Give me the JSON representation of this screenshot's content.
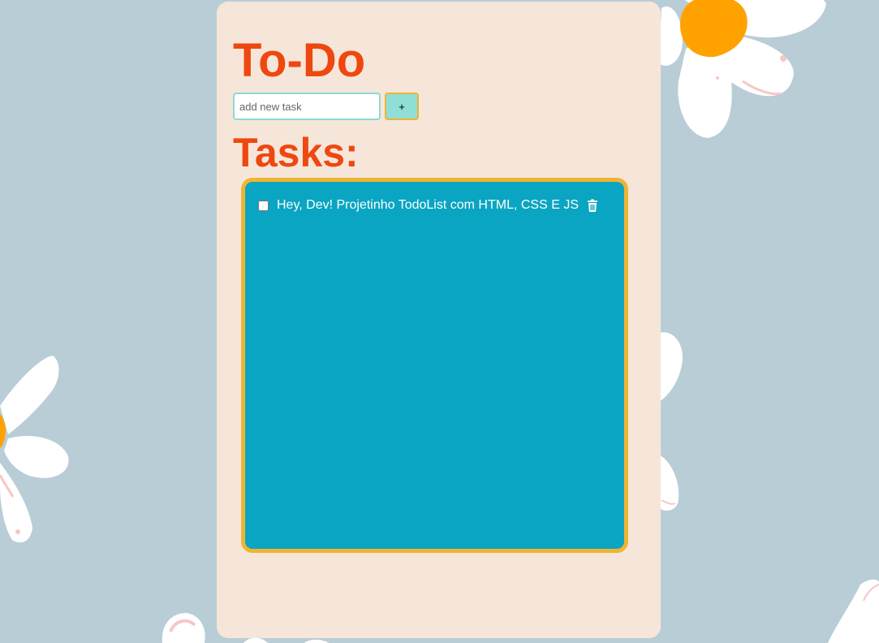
{
  "app": {
    "title": "To-Do"
  },
  "new_task": {
    "placeholder": "add new task",
    "value": "",
    "add_button_label": "+"
  },
  "tasks_section": {
    "heading": "Tasks:",
    "items": [
      {
        "text": "Hey, Dev! Projetinho TodoList com HTML, CSS E JS",
        "checked": false,
        "delete_icon": "trash-icon"
      }
    ]
  },
  "colors": {
    "background": "#b9cdd6",
    "card": "#f6e6da",
    "heading": "#ee4810",
    "task_list_bg": "#0aa5c2",
    "task_list_border": "#f0b432",
    "add_button_bg": "#8fdfd6",
    "flower_petal": "#ffffff",
    "flower_center": "#ffa200"
  }
}
